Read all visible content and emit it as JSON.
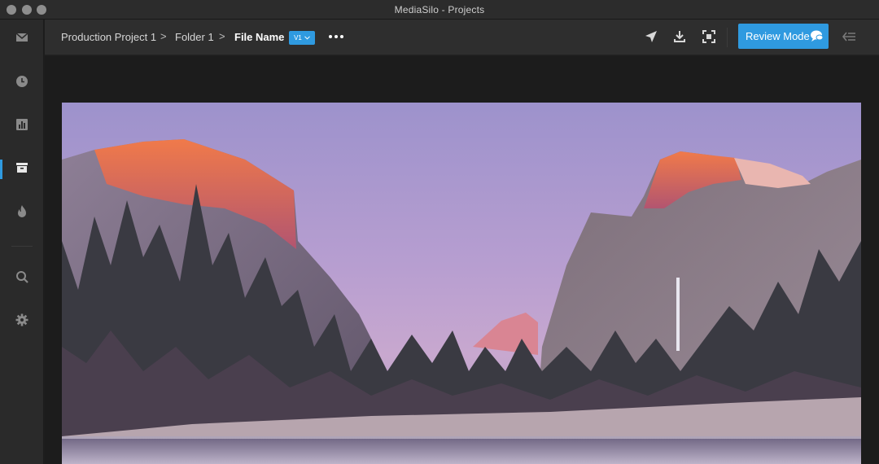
{
  "window": {
    "title": "MediaSilo  -  Projects"
  },
  "sidebar": {
    "items": [
      {
        "name": "inbox-icon"
      },
      {
        "name": "clock-icon"
      },
      {
        "name": "analytics-icon"
      },
      {
        "name": "archive-icon",
        "active": true
      },
      {
        "name": "flame-icon"
      },
      {
        "name": "search-icon"
      },
      {
        "name": "gear-icon"
      }
    ]
  },
  "header": {
    "breadcrumb": {
      "project": "Production Project 1",
      "folder": "Folder 1",
      "file": "File Name",
      "separator": ">"
    },
    "version": "V1",
    "icons": [
      "send-icon",
      "download-icon",
      "focus-icon",
      "collapse-icon"
    ],
    "review_mode_label": "Review Mode"
  },
  "colors": {
    "accent": "#2f9ae0",
    "background": "#1e1e1e",
    "sidebar": "#2a2a2a",
    "header": "#2e2e2e"
  }
}
